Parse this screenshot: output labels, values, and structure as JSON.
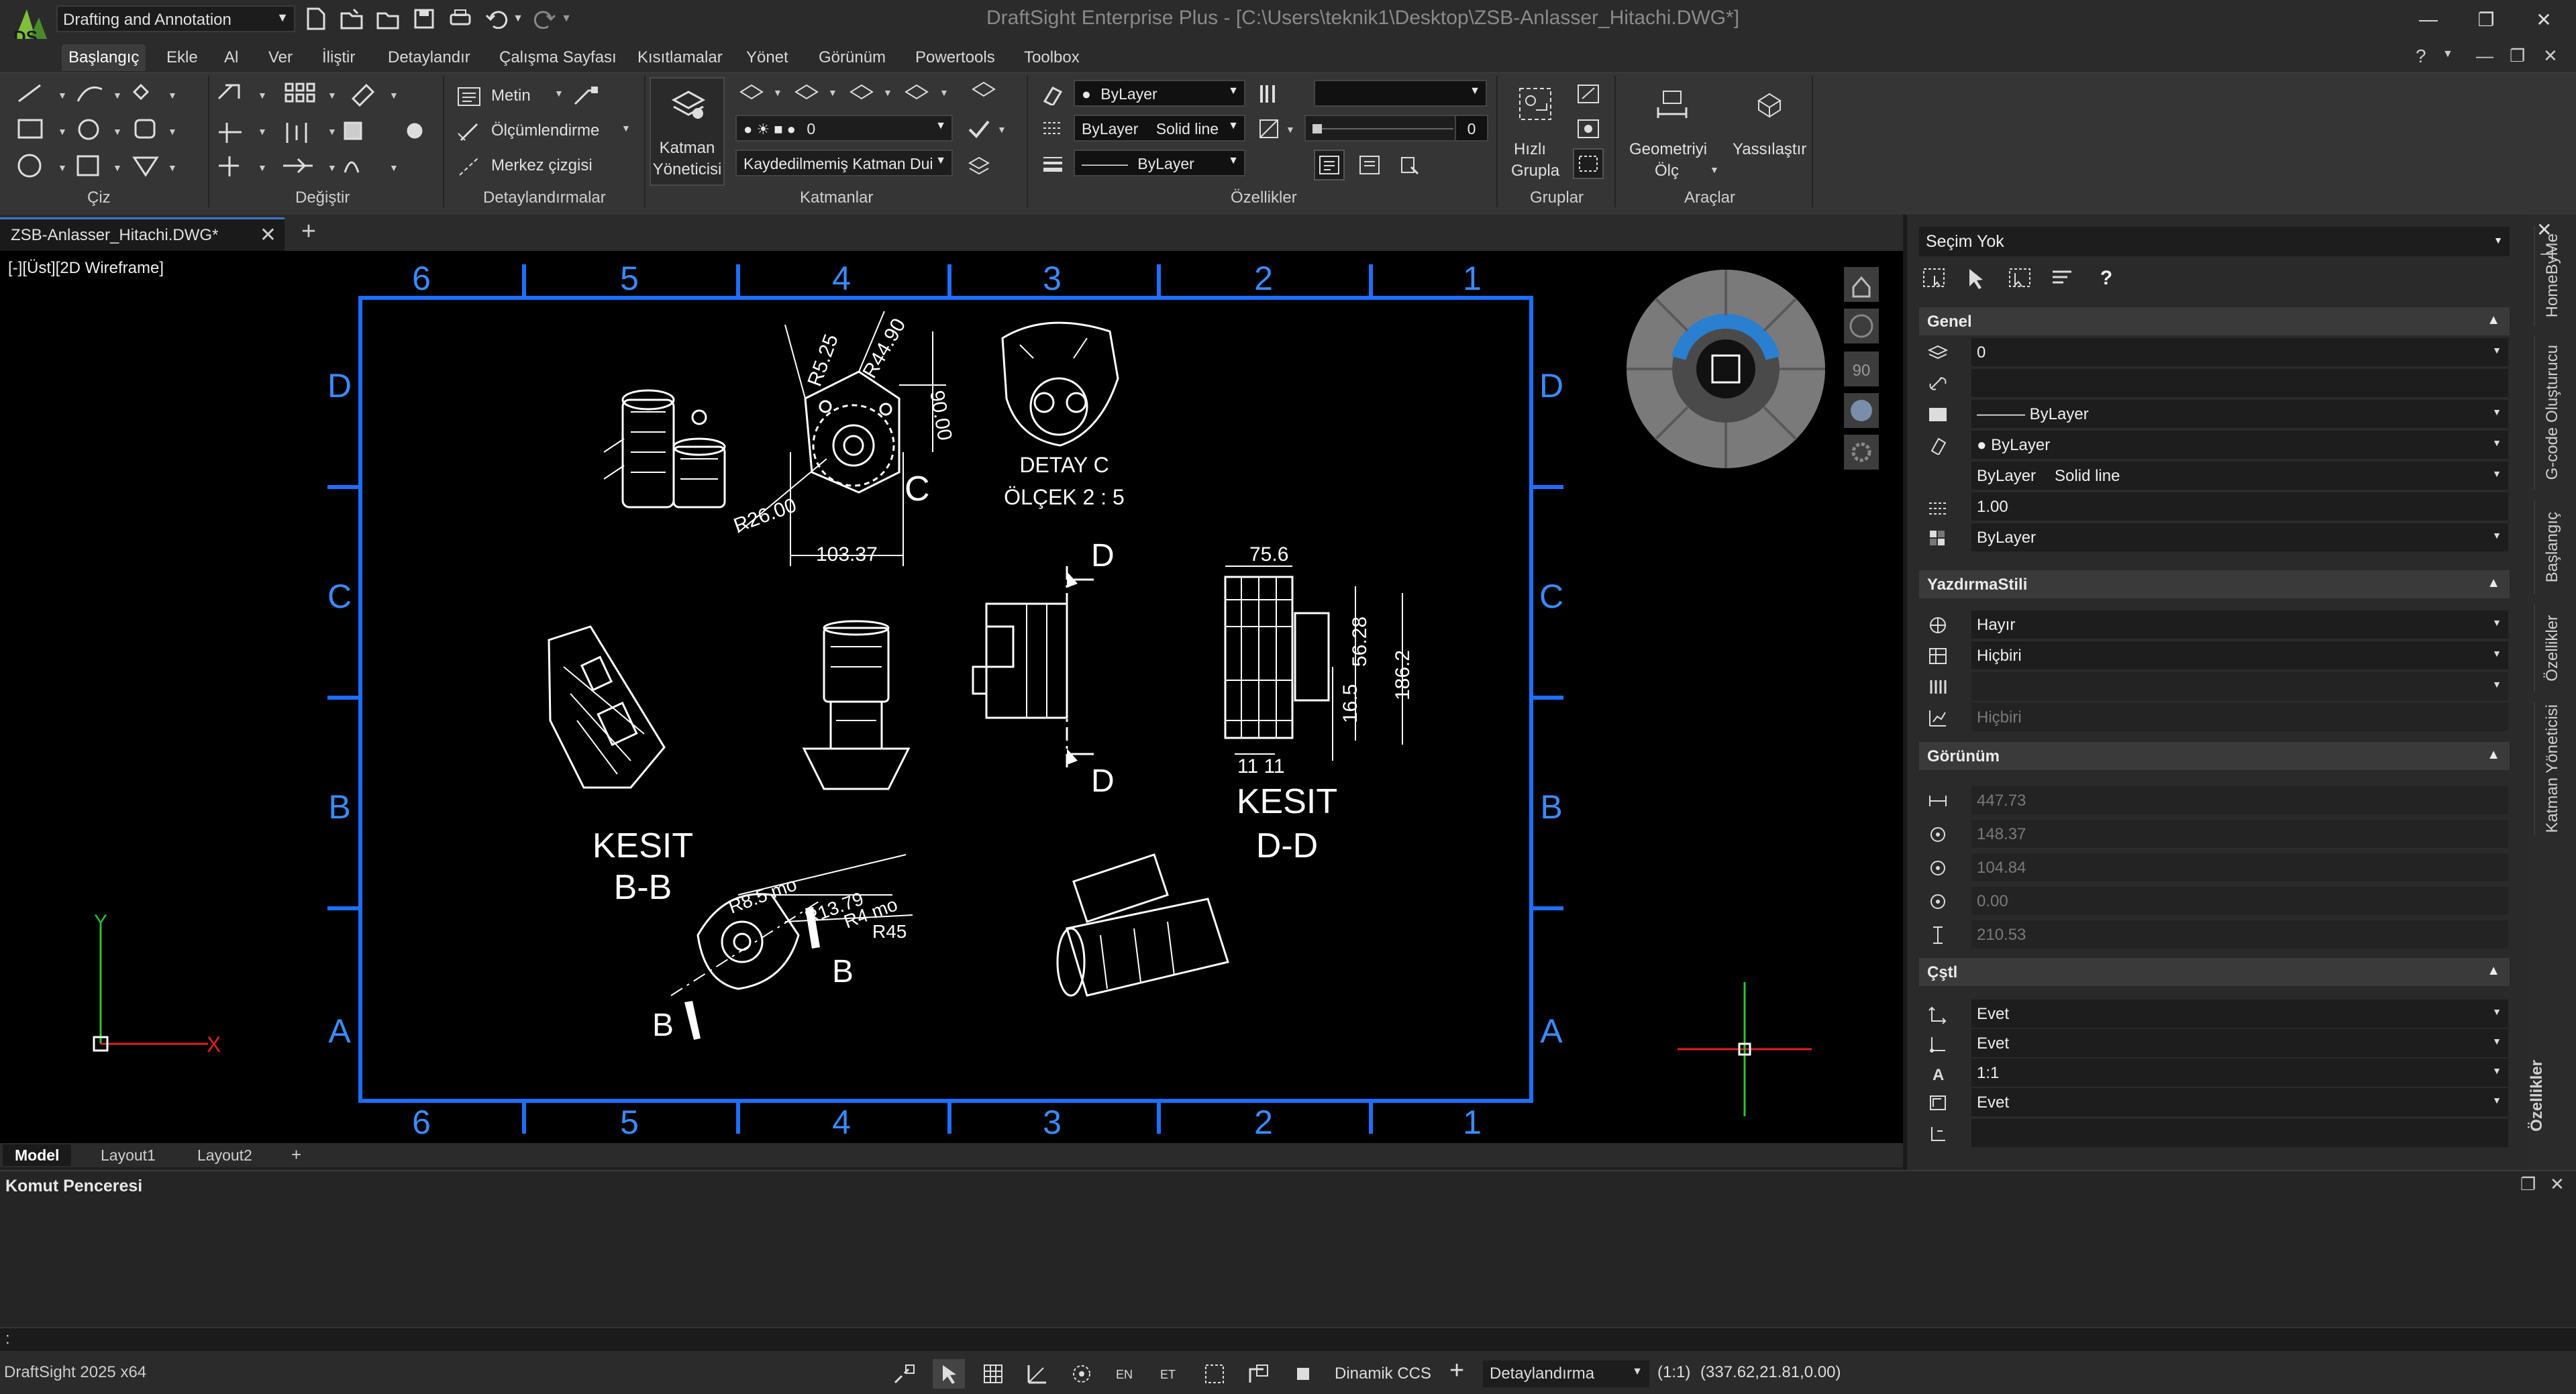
{
  "title_bar": {
    "workspace": "Drafting and Annotation",
    "app_title": "DraftSight Enterprise Plus",
    "file_path": "[C:\\Users\\teknik1\\Desktop\\ZSB-Anlasser_Hitachi.DWG*]",
    "separator": "-"
  },
  "menu": [
    "Başlangıç",
    "Ekle",
    "Al",
    "Ver",
    "İliştir",
    "Detaylandır",
    "Çalışma Sayfası",
    "Kısıtlamalar",
    "Yönet",
    "Görünüm",
    "Powertools",
    "Toolbox"
  ],
  "ribbon": {
    "panels": {
      "draw": "Çiz",
      "modify": "Değiştir",
      "annotation": "Detaylandırmalar",
      "layers": "Katmanlar",
      "properties": "Özellikler",
      "groups": "Gruplar",
      "tools": "Araçlar"
    },
    "text_label": "Metin",
    "dimension_label": "Ölçümlendirme",
    "centerline_label": "Merkez çizgisi",
    "layer_manager": [
      "Katman",
      "Yöneticisi"
    ],
    "layer_current": "0",
    "layer_state": "Kaydedilmemiş Katman Dui",
    "color": "ByLayer",
    "linestyle_1": "ByLayer",
    "linestyle_2": "Solid line",
    "lineweight": "ByLayer",
    "transparency": "0",
    "quick_group": [
      "Hızlı",
      "Grupla"
    ],
    "measure_geometry": [
      "Geometriyi",
      "Ölç"
    ],
    "flatten": "Yassılaştır"
  },
  "doc_tab": "ZSB-Anlasser_Hitachi.DWG*",
  "viewport": {
    "label": "[-][Üst][2D Wireframe]",
    "nav_rotation": "90"
  },
  "drawing": {
    "col_labels": [
      "6",
      "5",
      "4",
      "3",
      "2",
      "1"
    ],
    "row_labels": [
      "D",
      "C",
      "B",
      "A"
    ],
    "detail_c": "C",
    "detail_title": "DETAY C",
    "detail_scale": "ÖLÇEK 2 : 5",
    "section_b": [
      "KESIT",
      "B-B"
    ],
    "section_d": [
      "KESIT",
      "D-D"
    ],
    "dims": {
      "r525": "R5.25",
      "r4490": "R44.90",
      "d9000": "90.00",
      "r2600": "R26.00",
      "d10337": "103.37",
      "d756": "75.6",
      "d5628": "56.28",
      "d165": "16.5",
      "d1862": "186.2",
      "d1111": "11 11",
      "r85": "R8.5 mo",
      "r1379": "R13.79",
      "r4": "R4 mo",
      "r45": "R45"
    },
    "cut_b": "B",
    "cut_d": "D"
  },
  "layout_tabs": [
    "Model",
    "Layout1",
    "Layout2"
  ],
  "command": {
    "title": "Komut Penceresi",
    "prompt": ":"
  },
  "status": {
    "version": "DraftSight 2025 x64",
    "ccs": "Dinamik CCS",
    "annotation": "Detaylandırma",
    "scale": "(1:1)",
    "coords": "(337.62,21.81,0.00)"
  },
  "properties": {
    "selection": "Seçim Yok",
    "sections": {
      "general": "Genel",
      "print": "YazdırmaStili",
      "view": "Görünüm",
      "misc": "Çştl"
    },
    "general": {
      "layer": "0",
      "linestyle": "ByLayer",
      "color": "ByLayer",
      "lw_a": "ByLayer",
      "lw_b": "Solid line",
      "scale": "1.00",
      "transparency": "ByLayer"
    },
    "print": {
      "a": "Hayır",
      "b": "Hiçbiri",
      "d": "Hiçbiri"
    },
    "view": {
      "a": "447.73",
      "b": "148.37",
      "c": "104.84",
      "d": "0.00",
      "e": "210.53"
    },
    "misc": {
      "a": "Evet",
      "b": "Evet",
      "c": "1:1",
      "d": "Evet"
    }
  },
  "vertical_tabs": [
    "HomeByMe",
    "G-code Oluşturucu",
    "Başlangıç",
    "Özellikler",
    "Katman Yöneticisi"
  ],
  "props_panel_label": "Özellikler",
  "colors": {
    "frame": "#1e6fff",
    "label": "#3a8bff",
    "accent": "#3a78c8"
  }
}
